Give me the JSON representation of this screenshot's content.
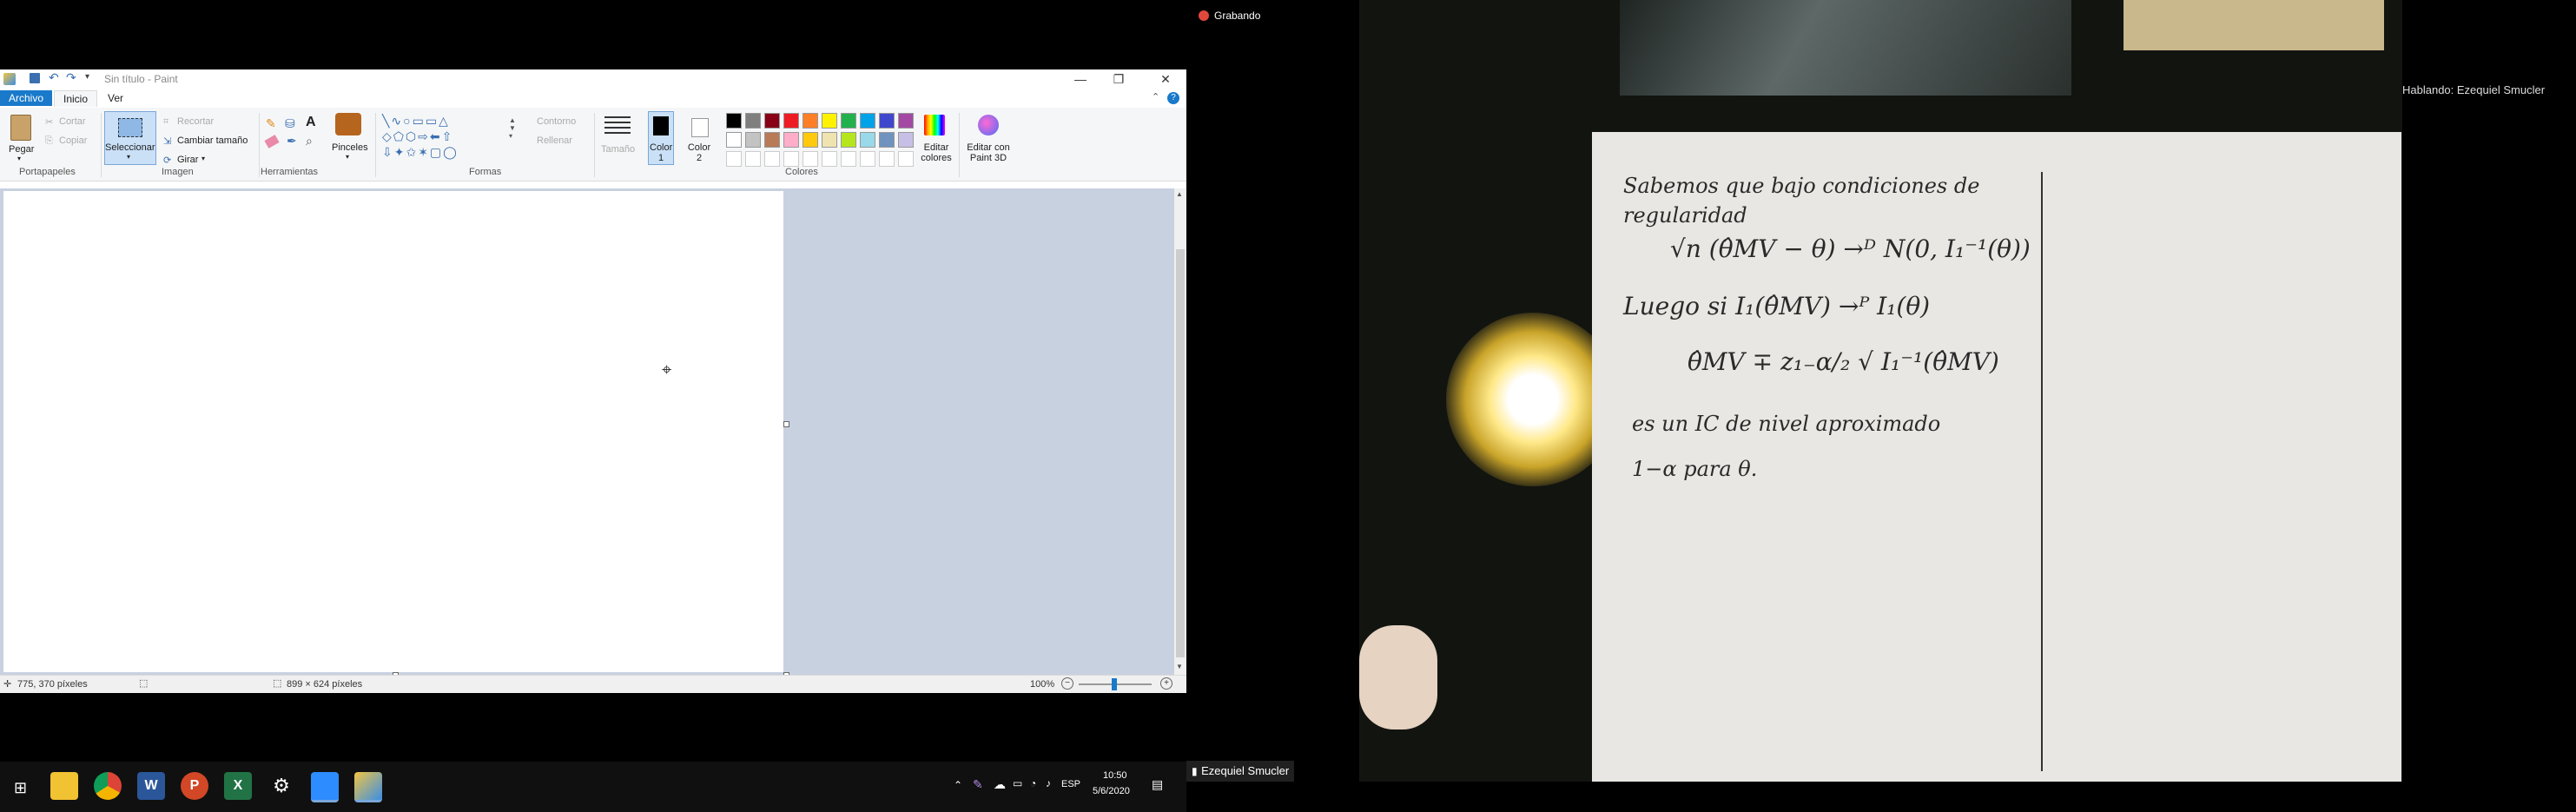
{
  "zoom": {
    "recording_label": "Grabando",
    "speaking_label": "Hablando: Ezequiel Smucler",
    "participant_name": "Ezequiel Smucler"
  },
  "paint": {
    "title": "Sin título - Paint",
    "tabs": [
      "Archivo",
      "Inicio",
      "Ver"
    ],
    "clipboard": {
      "paste": "Pegar",
      "cut": "Cortar",
      "copy": "Copiar",
      "group": "Portapapeles"
    },
    "image": {
      "select": "Seleccionar",
      "crop": "Recortar",
      "resize": "Cambiar tamaño",
      "rotate": "Girar",
      "group": "Imagen"
    },
    "tools": {
      "group": "Herramientas"
    },
    "brushes": "Pinceles",
    "shapes": {
      "outline": "Contorno",
      "fill": "Rellenar",
      "group": "Formas"
    },
    "size": "Tamaño",
    "color1": "Color 1",
    "color2": "Color 2",
    "colors_group": "Colores",
    "edit_colors": "Editar colores",
    "paint3d": "Editar con Paint 3D",
    "palette_row1": [
      "#000000",
      "#7f7f7f",
      "#880015",
      "#ed1c24",
      "#ff7f27",
      "#fff200",
      "#22b14c",
      "#00a2e8",
      "#3f48cc",
      "#a349a4"
    ],
    "palette_row2": [
      "#ffffff",
      "#c3c3c3",
      "#b97a57",
      "#ffaec9",
      "#ffc90e",
      "#efe4b0",
      "#b5e61d",
      "#99d9ea",
      "#7092be",
      "#c8bfe7"
    ],
    "status": {
      "cursor_pos": "775, 370 píxeles",
      "canvas_size": "899 × 624 píxeles",
      "zoom": "100%"
    }
  },
  "taskbar": {
    "lang": "ESP",
    "time": "10:50",
    "date": "5/6/2020"
  },
  "notes": {
    "line1": "Sabemos que bajo condiciones de",
    "line2": "regularidad",
    "line3": "√n (θ̂MV − θ)  →ᴰ  N(0, I₁⁻¹(θ))",
    "line4": "Luego si  I₁(θ̂MV) →ᴾ I₁(θ)",
    "line5": "θ̂MV ∓ z₁₋α/₂ √ I₁⁻¹(θ̂MV)",
    "line6": "es un IC de nivel aproximado",
    "line7": "1−α para θ."
  }
}
